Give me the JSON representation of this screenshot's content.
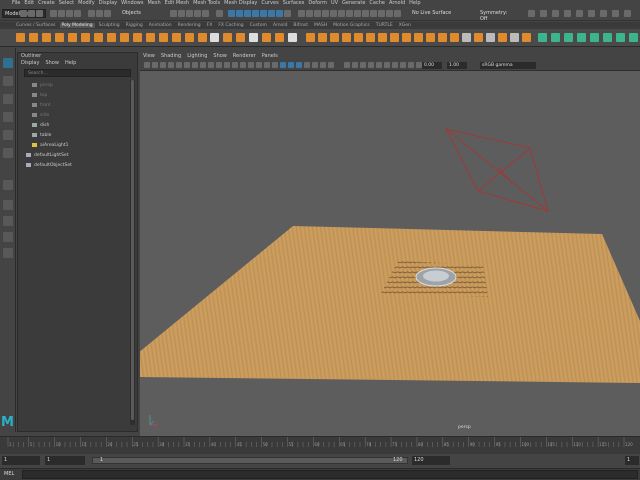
{
  "app": {
    "menu": [
      "File",
      "Edit",
      "Create",
      "Select",
      "Modify",
      "Display",
      "Windows",
      "Mesh",
      "Edit Mesh",
      "Mesh Tools",
      "Mesh Display",
      "Curves",
      "Surfaces",
      "Deform",
      "UV",
      "Generate",
      "Cache",
      "Arnold",
      "Help"
    ]
  },
  "statusline": {
    "mode": "Modeling",
    "objects": "Objects",
    "live": "No Live Surface",
    "symmetry": "Symmetry: Off"
  },
  "shelf": {
    "tabs": [
      "Curves / Surfaces",
      "Poly Modeling",
      "Sculpting",
      "Rigging",
      "Animation",
      "Rendering",
      "FX",
      "FX Caching",
      "Custom",
      "Arnold",
      "Bifrost",
      "MASH",
      "Motion Graphics",
      "TURTLE",
      "XGen"
    ],
    "active_tab": "Poly Modeling"
  },
  "outliner": {
    "title": "Outliner",
    "menu": [
      "Display",
      "Show",
      "Help"
    ],
    "search_placeholder": "Search...",
    "items": [
      {
        "label": "persp",
        "type": "camera",
        "dim": true
      },
      {
        "label": "top",
        "type": "camera",
        "dim": true
      },
      {
        "label": "front",
        "type": "camera",
        "dim": true
      },
      {
        "label": "side",
        "type": "camera",
        "dim": true
      },
      {
        "label": "dish",
        "type": "mesh",
        "dim": false
      },
      {
        "label": "table",
        "type": "mesh",
        "dim": false
      },
      {
        "label": "aiAreaLight1",
        "type": "light",
        "dim": false
      },
      {
        "label": "defaultLightSet",
        "type": "set",
        "dim": false
      },
      {
        "label": "defaultObjectSet",
        "type": "set",
        "dim": false
      }
    ]
  },
  "viewport": {
    "menu": [
      "View",
      "Shading",
      "Lighting",
      "Show",
      "Renderer",
      "Panels"
    ],
    "exposure": "0.00",
    "gamma": "1.00",
    "colorspace": "sRGB gamma",
    "camera_label": "persp"
  },
  "timeslider": {
    "ticks": [
      "1",
      "5",
      "10",
      "15",
      "20",
      "25",
      "30",
      "35",
      "40",
      "45",
      "50",
      "55",
      "60",
      "65",
      "70",
      "75",
      "80",
      "85",
      "90",
      "95",
      "100",
      "105",
      "110",
      "115",
      "120"
    ],
    "range_start": "1",
    "playback_start": "1",
    "range_bar_start": "1",
    "range_bar_end": "120",
    "range_end": "120",
    "playback_end": "1"
  },
  "commandline": {
    "label": "MEL"
  },
  "colors": {
    "accent_orange": "#e08a2e",
    "accent_teal": "#2ab0c8",
    "accent_green": "#3cb48c",
    "light_outline": "#b03030",
    "wood": "#c79a5b"
  }
}
